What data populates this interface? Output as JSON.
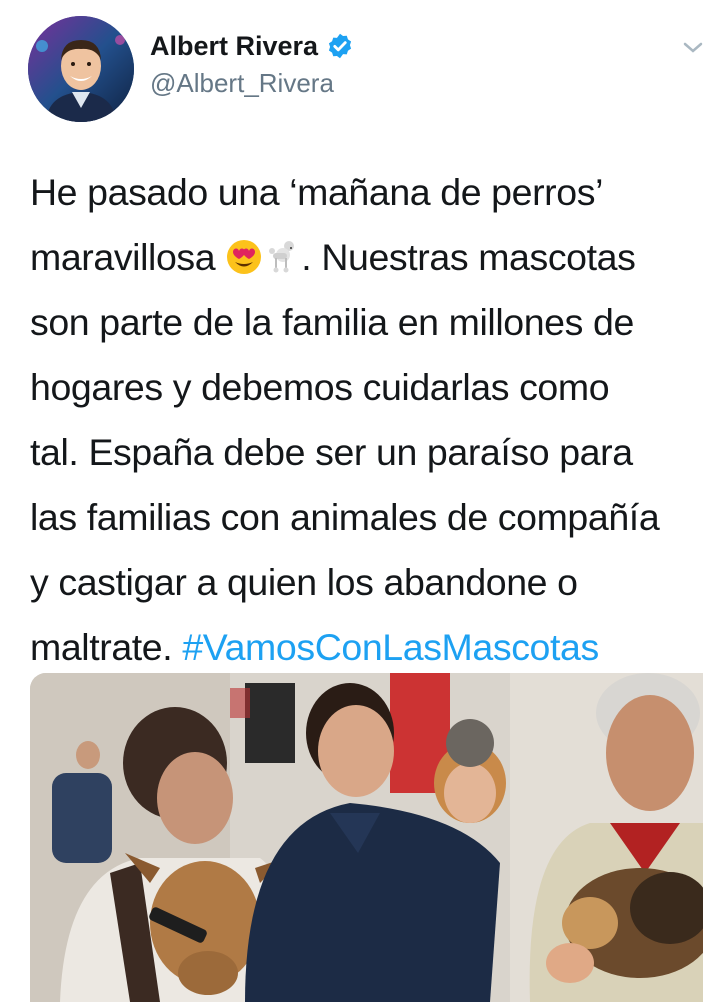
{
  "author": {
    "display_name": "Albert Rivera",
    "handle": "@Albert_Rivera",
    "verified": true,
    "avatar_icon": "profile-photo"
  },
  "tweet": {
    "lines": [
      "He pasado una ‘mañana de perros’",
      "maravillosa",
      ". Nuestras mascotas",
      "son parte de la familia en millones de",
      "hogares y debemos cuidarlas como",
      "tal. España debe ser un paraíso para",
      "las familias con animales de compañía",
      "y castigar a quien los abandone o",
      "maltrate. "
    ],
    "hashtag": "#VamosConLasMascotas",
    "emojis": [
      "smiling-face-with-heart-eyes-emoji",
      "poodle-emoji"
    ]
  },
  "media": {
    "type": "photo",
    "description_icon": "people-with-dogs-photo"
  },
  "colors": {
    "text": "#14171a",
    "secondary": "#657786",
    "link": "#1da1f2",
    "verified": "#1da1f2"
  }
}
